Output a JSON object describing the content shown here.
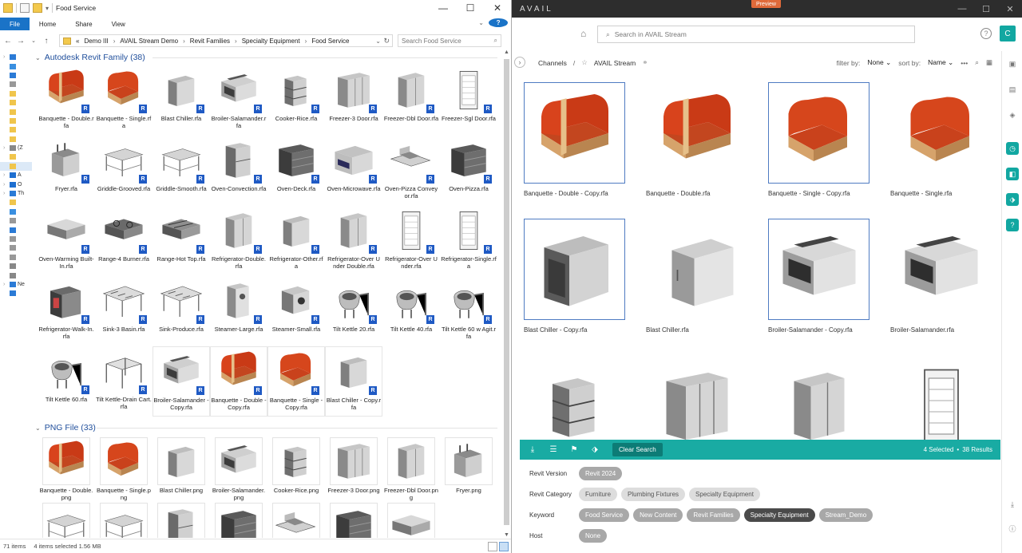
{
  "explorer": {
    "title": "Food Service",
    "ribbon": {
      "file": "File",
      "home": "Home",
      "share": "Share",
      "view": "View"
    },
    "crumbs": [
      "Demo III",
      "AVAIL Stream Demo",
      "Revit Families",
      "Specialty Equipment",
      "Food Service"
    ],
    "crumb_prefix": "«",
    "search_placeholder": "Search Food Service",
    "sidebar": [
      {
        "label": "",
        "icon": "star-icon"
      },
      {
        "label": "",
        "icon": "desktop-icon"
      },
      {
        "label": "",
        "icon": "download-icon"
      },
      {
        "label": "",
        "icon": "document-icon"
      },
      {
        "label": "",
        "icon": "folder-icon"
      },
      {
        "label": "",
        "icon": "folder-icon"
      },
      {
        "label": "",
        "icon": "folder-icon"
      },
      {
        "label": "",
        "icon": "folder-icon"
      },
      {
        "label": "",
        "icon": "folder-icon"
      },
      {
        "label": "",
        "icon": "folder-icon"
      },
      {
        "label": "(Z",
        "icon": "drive-icon"
      },
      {
        "label": "",
        "icon": "folder-icon"
      },
      {
        "label": "",
        "icon": "folder-icon"
      },
      {
        "label": "A",
        "icon": "cloud-icon"
      },
      {
        "label": "O",
        "icon": "cloud-icon"
      },
      {
        "label": "Th",
        "icon": "computer-icon"
      },
      {
        "label": "",
        "icon": "folder-icon"
      },
      {
        "label": "",
        "icon": "desktop-icon"
      },
      {
        "label": "",
        "icon": "document-icon"
      },
      {
        "label": "",
        "icon": "download-icon"
      },
      {
        "label": "",
        "icon": "music-icon"
      },
      {
        "label": "",
        "icon": "picture-icon"
      },
      {
        "label": "",
        "icon": "video-icon"
      },
      {
        "label": "",
        "icon": "drive-icon"
      },
      {
        "label": "",
        "icon": "drive-icon"
      },
      {
        "label": "Ne",
        "icon": "network-icon"
      },
      {
        "label": "",
        "icon": "computer-icon"
      }
    ],
    "group1": {
      "title": "Autodesk Revit Family (38)"
    },
    "group2": {
      "title": "PNG File (33)"
    },
    "rfa_files": [
      {
        "name": "Banquette - Double.rfa",
        "kind": "banqD"
      },
      {
        "name": "Banquette - Single.rfa",
        "kind": "banqS"
      },
      {
        "name": "Blast Chiller.rfa",
        "kind": "cabinet"
      },
      {
        "name": "Broiler-Salamander.rfa",
        "kind": "broiler"
      },
      {
        "name": "Cooker-Rice.rfa",
        "kind": "rice"
      },
      {
        "name": "Freezer-3 Door.rfa",
        "kind": "fridge3"
      },
      {
        "name": "Freezer-Dbl Door.rfa",
        "kind": "fridge2"
      },
      {
        "name": "Freezer-Sgl Door.rfa",
        "kind": "tall"
      },
      {
        "name": "Fryer.rfa",
        "kind": "fryer"
      },
      {
        "name": "Griddle-Grooved.rfa",
        "kind": "table"
      },
      {
        "name": "Griddle-Smooth.rfa",
        "kind": "table"
      },
      {
        "name": "Oven-Convection.rfa",
        "kind": "oven2"
      },
      {
        "name": "Oven-Deck.rfa",
        "kind": "deck"
      },
      {
        "name": "Oven-Microwave.rfa",
        "kind": "micro"
      },
      {
        "name": "Oven-Pizza Conveyor.rfa",
        "kind": "conveyor"
      },
      {
        "name": "Oven-Pizza.rfa",
        "kind": "deck"
      },
      {
        "name": "Oven-Warming Built-In.rfa",
        "kind": "warm"
      },
      {
        "name": "Range-4 Burner.rfa",
        "kind": "range"
      },
      {
        "name": "Range-Hot Top.rfa",
        "kind": "hottop"
      },
      {
        "name": "Refrigerator-Double.rfa",
        "kind": "fridge2"
      },
      {
        "name": "Refrigerator-Other.rfa",
        "kind": "cabinet"
      },
      {
        "name": "Refrigerator-Over Under Double.rfa",
        "kind": "fridge2"
      },
      {
        "name": "Refrigerator-Over Under.rfa",
        "kind": "tall"
      },
      {
        "name": "Refrigerator-Single.rfa",
        "kind": "tall"
      },
      {
        "name": "Refrigerator-Walk-In.rfa",
        "kind": "walkin"
      },
      {
        "name": "Sink-3 Basin.rfa",
        "kind": "sink"
      },
      {
        "name": "Sink-Produce.rfa",
        "kind": "sink"
      },
      {
        "name": "Steamer-Large.rfa",
        "kind": "steamer"
      },
      {
        "name": "Steamer-Small.rfa",
        "kind": "steamerS"
      },
      {
        "name": "Tilt Kettle 20.rfa",
        "kind": "kettle"
      },
      {
        "name": "Tilt Kettle 40.rfa",
        "kind": "kettle"
      },
      {
        "name": "Tilt Kettle 60 w Agit.rfa",
        "kind": "kettle"
      },
      {
        "name": "Tilt Kettle 60.rfa",
        "kind": "kettle"
      },
      {
        "name": "Tilt Kettle-Drain Cart.rfa",
        "kind": "cart"
      },
      {
        "name": "Broiler-Salamander - Copy.rfa",
        "kind": "broiler",
        "selected": true
      },
      {
        "name": "Banquette - Double - Copy.rfa",
        "kind": "banqD",
        "selected": true
      },
      {
        "name": "Banquette - Single - Copy.rfa",
        "kind": "banqS",
        "selected": true
      },
      {
        "name": "Blast Chiller - Copy.rfa",
        "kind": "cabinet",
        "selected": true
      }
    ],
    "png_files": [
      {
        "name": "Banquette - Double.png",
        "kind": "banqD"
      },
      {
        "name": "Banquette - Single.png",
        "kind": "banqS"
      },
      {
        "name": "Blast Chiller.png",
        "kind": "cabinet"
      },
      {
        "name": "Broiler-Salamander.png",
        "kind": "broiler"
      },
      {
        "name": "Cooker-Rice.png",
        "kind": "rice"
      },
      {
        "name": "Freezer-3 Door.png",
        "kind": "fridge3"
      },
      {
        "name": "Freezer-Dbl Door.png",
        "kind": "fridge2"
      },
      {
        "name": "Fryer.png",
        "kind": "fryer"
      },
      {
        "name": "",
        "kind": "table"
      },
      {
        "name": "",
        "kind": "table"
      },
      {
        "name": "",
        "kind": "oven2"
      },
      {
        "name": "",
        "kind": "deck"
      },
      {
        "name": "",
        "kind": "conveyor"
      },
      {
        "name": "",
        "kind": "deck"
      },
      {
        "name": "",
        "kind": "warm"
      }
    ],
    "status": {
      "count": "71 items",
      "selected": "4 items selected  1.56 MB"
    }
  },
  "avail": {
    "logo": "AVAIL",
    "preview": "Preview",
    "search_placeholder": "Search in AVAIL Stream",
    "avatar": "C",
    "crumb": {
      "channels": "Channels",
      "slash": "/",
      "stream": "AVAIL Stream"
    },
    "filter": {
      "filter_label": "filter by:",
      "filter_value": "None",
      "sort_label": "sort by:",
      "sort_value": "Name"
    },
    "cards": [
      {
        "name": "Banquette - Double - Copy.rfa",
        "kind": "banqD",
        "selected": true
      },
      {
        "name": "Banquette - Double.rfa",
        "kind": "banqD",
        "selected": false
      },
      {
        "name": "Banquette - Single - Copy.rfa",
        "kind": "banqS",
        "selected": true
      },
      {
        "name": "Banquette - Single.rfa",
        "kind": "banqS",
        "selected": false
      },
      {
        "name": "Blast Chiller - Copy.rfa",
        "kind": "chiller",
        "selected": true
      },
      {
        "name": "Blast Chiller.rfa",
        "kind": "cabinetL",
        "selected": false
      },
      {
        "name": "Broiler-Salamander - Copy.rfa",
        "kind": "broilerL",
        "selected": true
      },
      {
        "name": "Broiler-Salamander.rfa",
        "kind": "broilerL",
        "selected": false
      },
      {
        "name": "",
        "kind": "rice",
        "selected": false
      },
      {
        "name": "",
        "kind": "fridge3",
        "selected": false
      },
      {
        "name": "",
        "kind": "fridge2",
        "selected": false
      },
      {
        "name": "",
        "kind": "tall",
        "selected": false
      }
    ],
    "bar": {
      "clear": "Clear Search",
      "selected": "4 Selected",
      "dot": "•",
      "results": "38 Results"
    },
    "meta": [
      {
        "key": "Revit Version",
        "chips": [
          {
            "t": "Revit 2024",
            "s": "gray"
          }
        ]
      },
      {
        "key": "Revit Category",
        "chips": [
          {
            "t": "Furniture",
            "s": ""
          },
          {
            "t": "Plumbing Fixtures",
            "s": ""
          },
          {
            "t": "Specialty Equipment",
            "s": ""
          }
        ]
      },
      {
        "key": "Keyword",
        "chips": [
          {
            "t": "Food Service",
            "s": "gray"
          },
          {
            "t": "New Content",
            "s": "gray"
          },
          {
            "t": "Revit Families",
            "s": "gray"
          },
          {
            "t": "Specialty Equipment",
            "s": "dark"
          },
          {
            "t": "Stream_Demo",
            "s": "gray"
          }
        ]
      },
      {
        "key": "Host",
        "chips": [
          {
            "t": "None",
            "s": "gray"
          }
        ]
      }
    ]
  }
}
